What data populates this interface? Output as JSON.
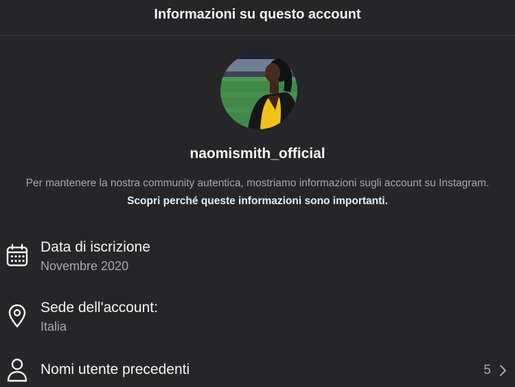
{
  "header": {
    "title": "Informazioni su questo account"
  },
  "profile": {
    "username": "naomismith_official",
    "info_text": "Per mantenere la nostra community autentica, mostriamo informazioni sugli account su Instagram.",
    "info_link": "Scopri perché queste informazioni sono importanti."
  },
  "rows": {
    "join_date": {
      "icon": "calendar-icon",
      "title": "Data di iscrizione",
      "value": "Novembre 2020"
    },
    "location": {
      "icon": "location-pin-icon",
      "title": "Sede dell'account:",
      "value": "Italia"
    },
    "former_usernames": {
      "icon": "person-icon",
      "title": "Nomi utente precedenti",
      "count": "5"
    }
  },
  "colors": {
    "background": "#262629",
    "text_primary": "#f5f5f5",
    "text_secondary": "#a8a8ad",
    "link": "#e0f1ff",
    "avatar_accent": "#f2c21b"
  }
}
